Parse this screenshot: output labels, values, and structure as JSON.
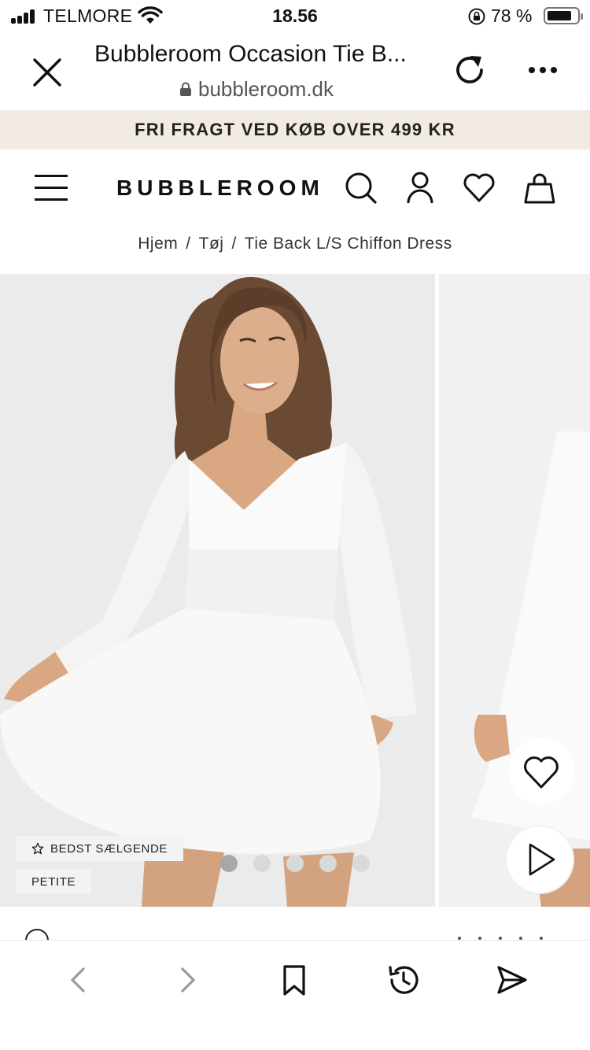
{
  "status_bar": {
    "carrier": "TELMORE",
    "time": "18.56",
    "battery_percent": "78 %",
    "battery_level": 0.78
  },
  "browser": {
    "page_title": "Bubbleroom Occasion Tie B...",
    "url": "bubbleroom.dk"
  },
  "promo": {
    "text": "FRI FRAGT VED KØB OVER 499 KR"
  },
  "site_header": {
    "logo": "BUBBLEROOM"
  },
  "breadcrumb": {
    "items": [
      "Hjem",
      "Tøj",
      "Tie Back L/S Chiffon Dress"
    ],
    "separator": "/"
  },
  "gallery": {
    "badges": [
      "BEDST SÆLGENDE",
      "PETITE"
    ],
    "slide_count": 5,
    "active_slide": 1
  },
  "icons": {
    "close": "close-icon",
    "reload": "reload-icon",
    "more": "more-icon",
    "menu": "menu-icon",
    "search": "search-icon",
    "account": "user-icon",
    "wishlist": "heart-icon",
    "cart": "bag-icon",
    "back": "chevron-left-icon",
    "forward": "chevron-right-icon",
    "bookmarks": "bookmark-icon",
    "history": "history-icon",
    "share": "send-icon"
  },
  "colors": {
    "promo_bg": "#f2ebe4",
    "photo_bg": "#ebebeb"
  }
}
